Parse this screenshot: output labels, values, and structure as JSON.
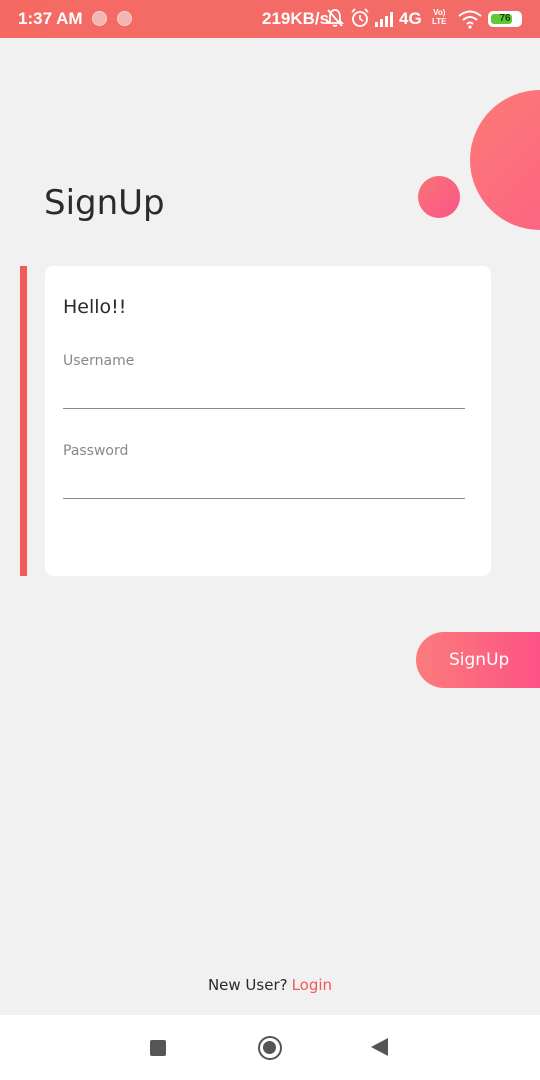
{
  "status_bar": {
    "time": "1:37 AM",
    "speed": "219KB/s",
    "network": "4G",
    "network_sub": "Vo)",
    "lte": "LTE",
    "battery": "76",
    "battery_level": 0.76,
    "icons": [
      "notification-dot-icon",
      "notification-dot-icon",
      "mute-bell-icon",
      "alarm-icon",
      "signal-icon",
      "wifi-icon",
      "battery-icon"
    ]
  },
  "page": {
    "title": "SignUp"
  },
  "form": {
    "heading": "Hello!!",
    "username_label": "Username",
    "username_value": "",
    "password_label": "Password",
    "password_value": ""
  },
  "actions": {
    "signup_label": "SignUp"
  },
  "footer": {
    "prompt": "New User?",
    "login_link": "Login"
  },
  "colors": {
    "accent": "#f05c5a",
    "gradient_start": "#fb7c7b",
    "gradient_end": "#fd4d86",
    "background": "#f2f1f1"
  }
}
